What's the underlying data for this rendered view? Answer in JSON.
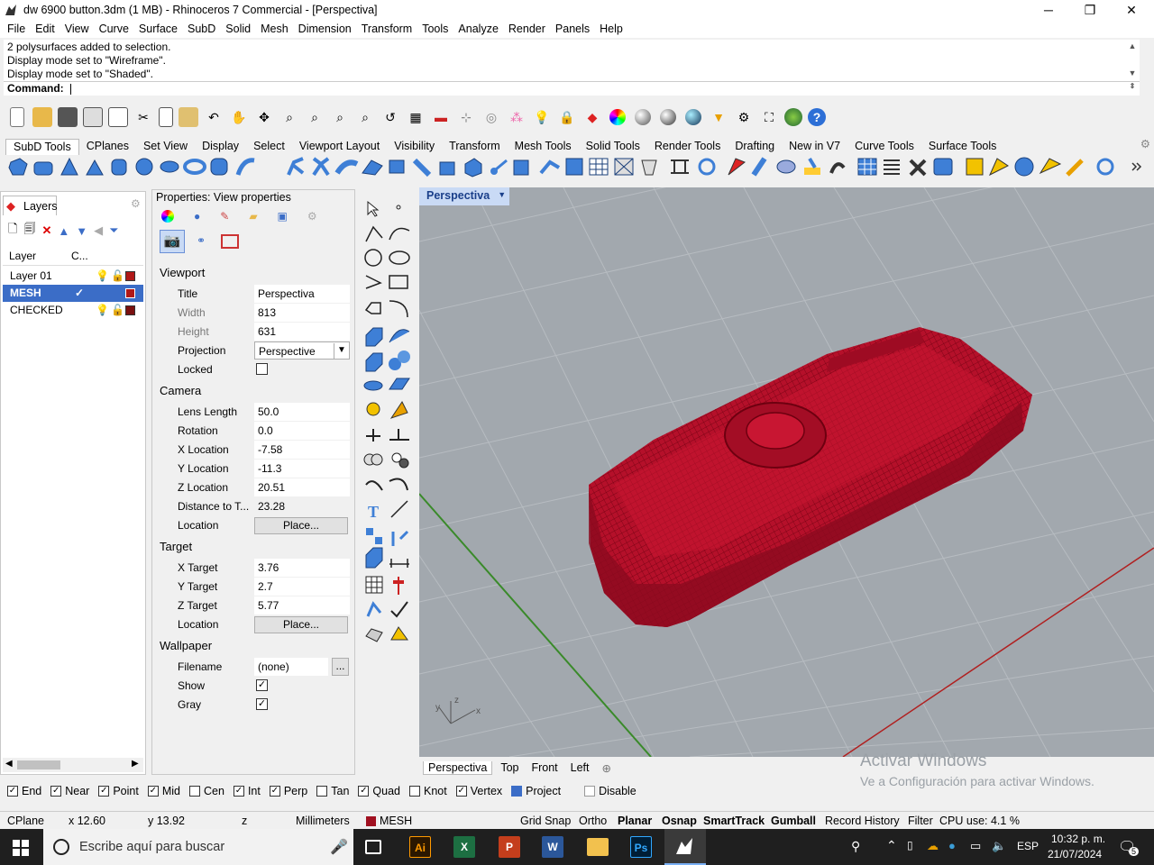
{
  "window": {
    "title": "dw 6900 button.3dm (1 MB) - Rhinoceros 7 Commercial - [Perspectiva]",
    "minimize": "─",
    "maximize": "❐",
    "close": "✕"
  },
  "menu": [
    "File",
    "Edit",
    "View",
    "Curve",
    "Surface",
    "SubD",
    "Solid",
    "Mesh",
    "Dimension",
    "Transform",
    "Tools",
    "Analyze",
    "Render",
    "Panels",
    "Help"
  ],
  "command_history": [
    "2 polysurfaces added to selection.",
    "Display mode set to \"Wireframe\".",
    "Display mode set to \"Shaded\"."
  ],
  "command_prompt": "Command:",
  "toolbar_tabs": [
    "SubD Tools",
    "CPlanes",
    "Set View",
    "Display",
    "Select",
    "Viewport Layout",
    "Visibility",
    "Transform",
    "Mesh Tools",
    "Solid Tools",
    "Render Tools",
    "Drafting",
    "New in V7",
    "Curve Tools",
    "Surface Tools"
  ],
  "layers": {
    "tab": "Layers",
    "col_layer": "Layer",
    "col_c": "C...",
    "rows": [
      {
        "name": "Layer 01",
        "color": "#b01818"
      },
      {
        "name": "MESH",
        "color": "#b01818",
        "check": "✓"
      },
      {
        "name": "CHECKED",
        "color": "#7a1010"
      }
    ]
  },
  "properties": {
    "header": "Properties: View properties",
    "viewport_section": "Viewport",
    "title_label": "Title",
    "title_value": "Perspectiva",
    "width_label": "Width",
    "width_value": "813",
    "height_label": "Height",
    "height_value": "631",
    "projection_label": "Projection",
    "projection_value": "Perspective",
    "locked_label": "Locked",
    "camera_section": "Camera",
    "lens_label": "Lens Length",
    "lens_value": "50.0",
    "rotation_label": "Rotation",
    "rotation_value": "0.0",
    "xloc_label": "X Location",
    "xloc_value": "-7.58",
    "yloc_label": "Y Location",
    "yloc_value": "-11.3",
    "zloc_label": "Z Location",
    "zloc_value": "20.51",
    "dist_label": "Distance to T...",
    "dist_value": "23.28",
    "location_label": "Location",
    "place_button": "Place...",
    "target_section": "Target",
    "xt_label": "X Target",
    "xt_value": "3.76",
    "yt_label": "Y Target",
    "yt_value": "2.7",
    "zt_label": "Z Target",
    "zt_value": "5.77",
    "wallpaper_section": "Wallpaper",
    "filename_label": "Filename",
    "filename_value": "(none)",
    "browse": "...",
    "show_label": "Show",
    "gray_label": "Gray",
    "check": "✓"
  },
  "viewport": {
    "name": "Perspectiva",
    "tabs": [
      "Perspectiva",
      "Top",
      "Front",
      "Left"
    ],
    "add_tab": "⊕",
    "watermark_title": "Activar Windows",
    "watermark_sub": "Ve a Configuración para activar Windows.",
    "axis_x": "x",
    "axis_y": "y",
    "axis_z": "z",
    "mesh_color": "#b5102a"
  },
  "osnaps": [
    {
      "label": "End",
      "on": true
    },
    {
      "label": "Near",
      "on": true
    },
    {
      "label": "Point",
      "on": true
    },
    {
      "label": "Mid",
      "on": true
    },
    {
      "label": "Cen",
      "on": false
    },
    {
      "label": "Int",
      "on": true
    },
    {
      "label": "Perp",
      "on": true
    },
    {
      "label": "Tan",
      "on": false
    },
    {
      "label": "Quad",
      "on": true
    },
    {
      "label": "Knot",
      "on": false
    },
    {
      "label": "Vertex",
      "on": true
    },
    {
      "label": "Project",
      "on": false
    },
    {
      "label": "Disable",
      "on": false
    }
  ],
  "status": {
    "cplane": "CPlane",
    "x": "x 12.60",
    "y": "y 13.92",
    "z": "z",
    "units": "Millimeters",
    "layer": "MESH",
    "grid_snap": "Grid Snap",
    "ortho": "Ortho",
    "planar": "Planar",
    "osnap": "Osnap",
    "smarttrack": "SmartTrack",
    "gumball": "Gumball",
    "record_history": "Record History",
    "filter": "Filter",
    "cpu": "CPU use: 4.1 %"
  },
  "taskbar": {
    "search_placeholder": "Escribe aquí para buscar",
    "lang": "ESP",
    "time": "10:32 p. m.",
    "date": "21/07/2024",
    "notif": "5"
  }
}
